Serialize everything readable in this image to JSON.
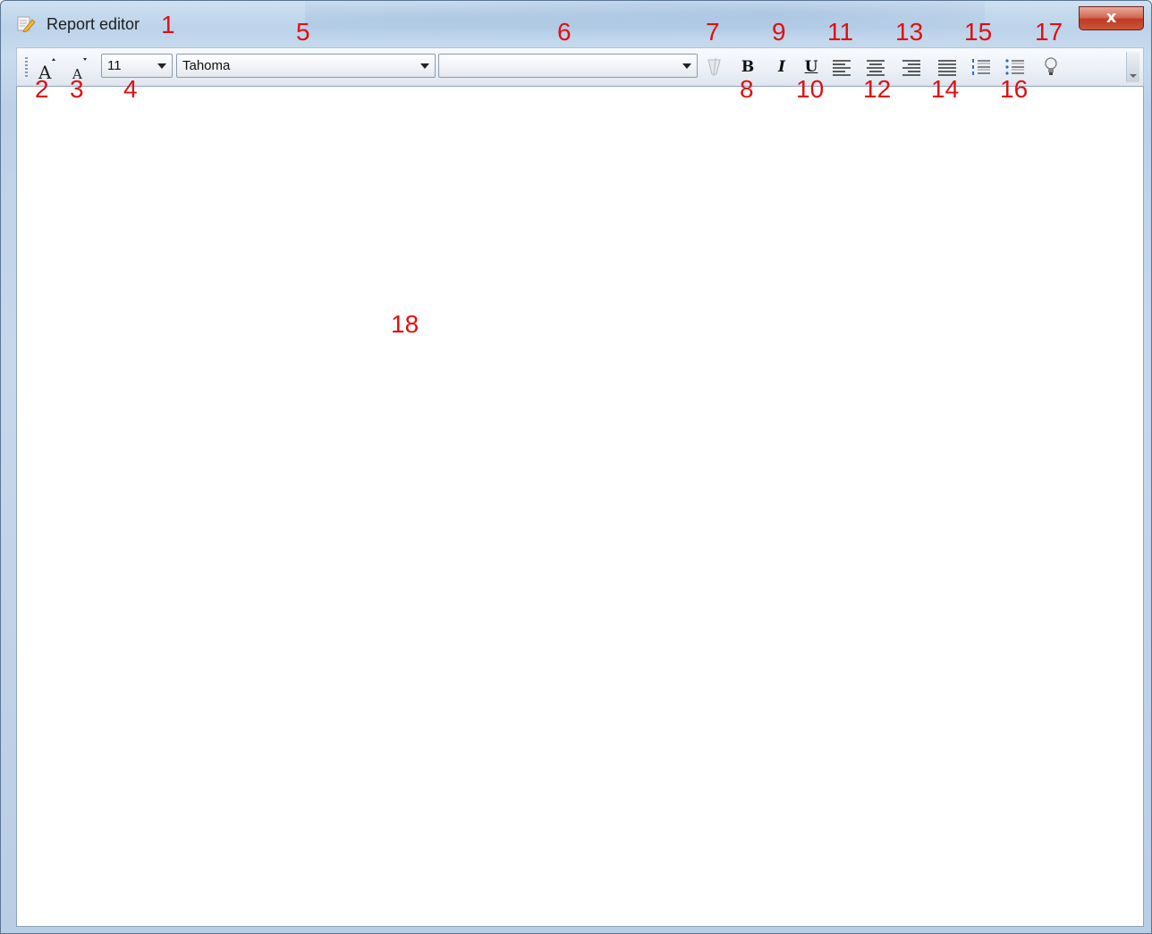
{
  "window": {
    "title": "Report editor",
    "close_label": "x"
  },
  "toolbar": {
    "font_size": "11",
    "font_name": "Tahoma",
    "style_value": "",
    "bold_label": "B",
    "italic_label": "I",
    "underline_label": "U"
  },
  "callouts": {
    "c1": "1",
    "c2": "2",
    "c3": "3",
    "c4": "4",
    "c5": "5",
    "c6": "6",
    "c7": "7",
    "c8": "8",
    "c9": "9",
    "c10": "10",
    "c11": "11",
    "c12": "12",
    "c13": "13",
    "c14": "14",
    "c15": "15",
    "c16": "16",
    "c17": "17",
    "c18": "18"
  },
  "colors": {
    "callout": "#e01010",
    "titlebar": "#bcd3ea",
    "close_button": "#c9563a"
  },
  "icons": {
    "app": "report-edit-icon",
    "grow": "font-size-increase-icon",
    "shrink": "font-size-decrease-icon",
    "clear": "clear-formatting-icon",
    "align_left": "align-left-icon",
    "align_center": "align-center-icon",
    "align_right": "align-right-icon",
    "justify": "justify-icon",
    "numbered": "numbered-list-icon",
    "bulleted": "bulleted-list-icon",
    "bulb": "lightbulb-icon"
  }
}
